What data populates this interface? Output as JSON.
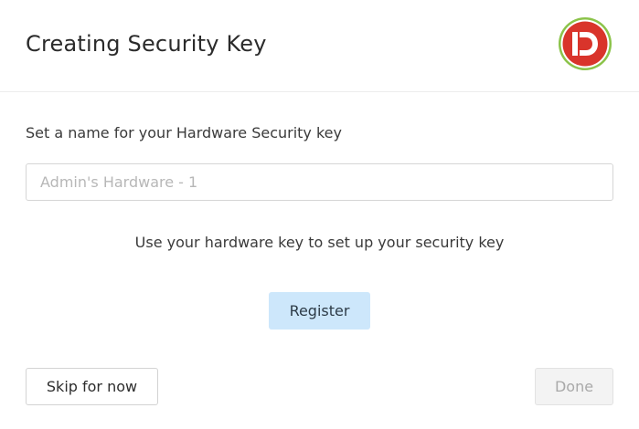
{
  "dialog": {
    "title": "Creating Security Key",
    "logo_icon": "id-brand-logo",
    "colors": {
      "logo_red": "#d9342b",
      "logo_ring": "#8bc34a",
      "register_bg": "#cde7fb",
      "done_disabled_bg": "#f3f3f3"
    }
  },
  "form": {
    "name_label": "Set a name for your Hardware Security key",
    "name_placeholder": "Admin's Hardware - 1",
    "name_value": "",
    "instruction": "Use your hardware key to set up your security key",
    "register_label": "Register"
  },
  "footer": {
    "skip_label": "Skip for now",
    "done_label": "Done",
    "done_disabled": true
  }
}
